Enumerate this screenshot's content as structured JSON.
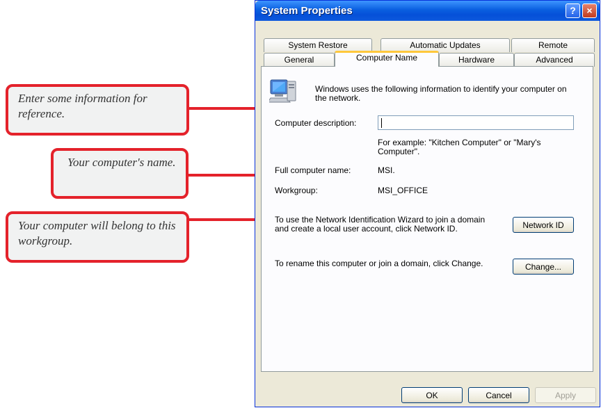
{
  "window": {
    "title": "System Properties",
    "help_glyph": "?",
    "close_glyph": "×"
  },
  "tabs": {
    "row_back": [
      "System Restore",
      "Automatic Updates",
      "Remote"
    ],
    "row_front": [
      "General",
      "Computer Name",
      "Hardware",
      "Advanced"
    ],
    "active": "Computer Name"
  },
  "panel": {
    "intro": "Windows uses the following information to identify your computer on the network.",
    "description_label": "Computer description:",
    "description_value": "",
    "example_text": "For example: \"Kitchen Computer\" or \"Mary's Computer\".",
    "full_name_label": "Full computer name:",
    "full_name_value": "MSI.",
    "workgroup_label": "Workgroup:",
    "workgroup_value": "MSI_OFFICE",
    "wizard_text": "To use the Network Identification Wizard to join a domain and create a local user account, click Network ID.",
    "network_id_button": "Network ID",
    "rename_text": "To rename this computer or join a domain, click Change.",
    "change_button": "Change..."
  },
  "footer": {
    "ok": "OK",
    "cancel": "Cancel",
    "apply": "Apply"
  },
  "callouts": {
    "description": "Enter some information for reference.",
    "name": "Your computer's name.",
    "workgroup": "Your computer will belong to this workgroup."
  },
  "colors": {
    "callout_border": "#e4222b",
    "titlebar": "#0a5fe0",
    "dialog_bg": "#ece9d8"
  },
  "icons": {
    "computer": "computer-icon"
  }
}
